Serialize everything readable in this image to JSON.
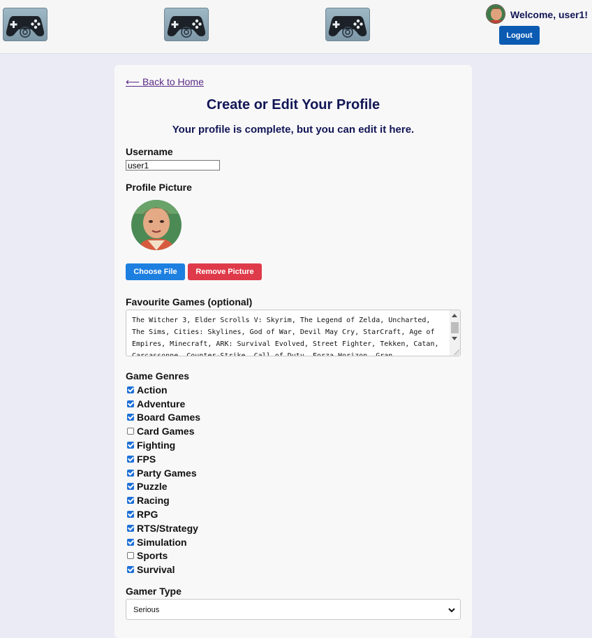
{
  "header": {
    "logos": [
      "gamepad-logo",
      "gamepad-logo",
      "gamepad-logo"
    ],
    "welcome_text": "Welcome, user1!",
    "logout_label": "Logout"
  },
  "page": {
    "back_link": "⟵ Back to Home",
    "title": "Create or Edit Your Profile",
    "subtitle": "Your profile is complete, but you can edit it here."
  },
  "form": {
    "username_label": "Username",
    "username_value": "user1",
    "profile_picture_label": "Profile Picture",
    "choose_file_label": "Choose File",
    "remove_picture_label": "Remove Picture",
    "favourite_games_label": "Favourite Games (optional)",
    "favourite_games_value": "The Witcher 3, Elder Scrolls V: Skyrim, The Legend of Zelda, Uncharted, The Sims, Cities: Skylines, God of War, Devil May Cry, StarCraft, Age of Empires, Minecraft, ARK: Survival Evolved, Street Fighter, Tekken, Catan, Carcassonne, Counter-Strike, Call of Duty, Forza Horizon, Gran",
    "genres_label": "Game Genres",
    "genres": [
      {
        "label": "Action",
        "checked": true
      },
      {
        "label": "Adventure",
        "checked": true
      },
      {
        "label": "Board Games",
        "checked": true
      },
      {
        "label": "Card Games",
        "checked": false
      },
      {
        "label": "Fighting",
        "checked": true
      },
      {
        "label": "FPS",
        "checked": true
      },
      {
        "label": "Party Games",
        "checked": true
      },
      {
        "label": "Puzzle",
        "checked": true
      },
      {
        "label": "Racing",
        "checked": true
      },
      {
        "label": "RPG",
        "checked": true
      },
      {
        "label": "RTS/Strategy",
        "checked": true
      },
      {
        "label": "Simulation",
        "checked": true
      },
      {
        "label": "Sports",
        "checked": false
      },
      {
        "label": "Survival",
        "checked": true
      }
    ],
    "gamer_type_label": "Gamer Type",
    "gamer_type_value": "Serious"
  },
  "colors": {
    "primary": "#1d7fe0",
    "danger": "#df3a4a",
    "logout": "#0b5bb3",
    "heading": "#121655",
    "background": "#ebebf5"
  }
}
